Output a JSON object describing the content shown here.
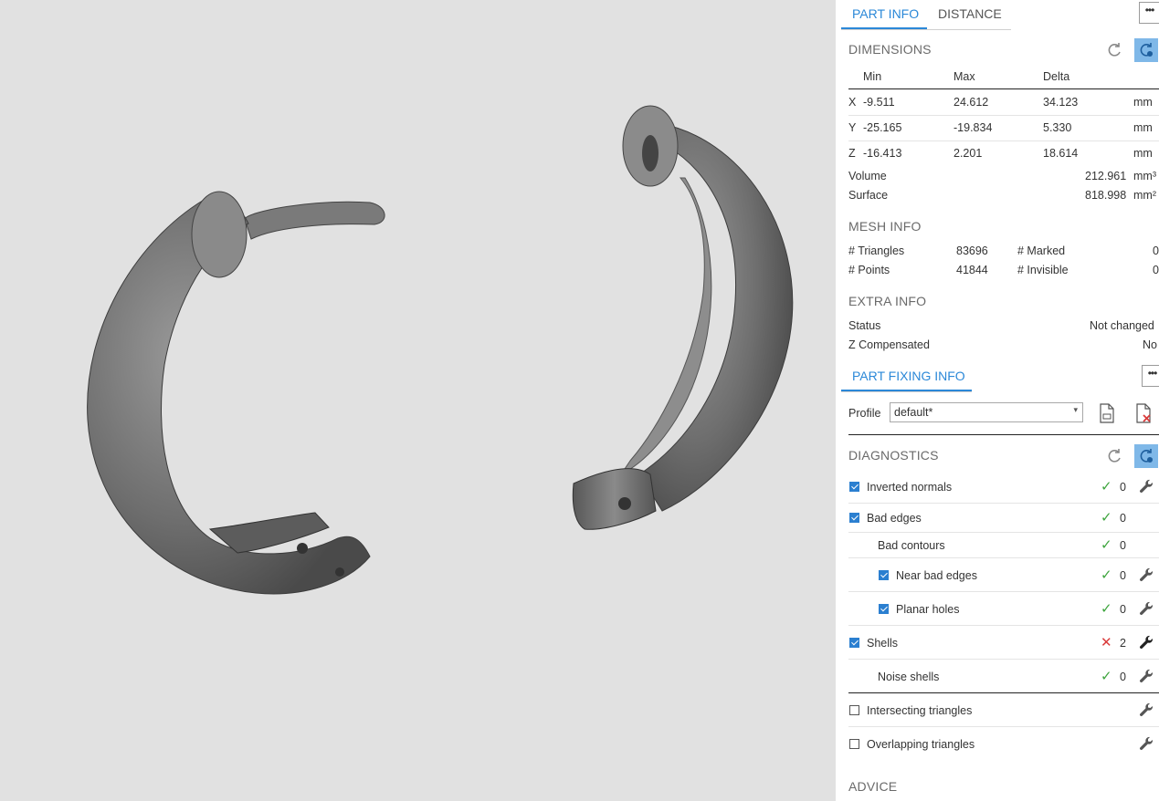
{
  "tabs": {
    "part_info": "PART INFO",
    "distance": "DISTANCE",
    "more": "•••"
  },
  "dimensions": {
    "title": "DIMENSIONS",
    "headers": {
      "min": "Min",
      "max": "Max",
      "delta": "Delta"
    },
    "rows": [
      {
        "axis": "X",
        "min": "-9.511",
        "max": "24.612",
        "delta": "34.123",
        "unit": "mm"
      },
      {
        "axis": "Y",
        "min": "-25.165",
        "max": "-19.834",
        "delta": "5.330",
        "unit": "mm"
      },
      {
        "axis": "Z",
        "min": "-16.413",
        "max": "2.201",
        "delta": "18.614",
        "unit": "mm"
      }
    ],
    "volume_label": "Volume",
    "volume_value": "212.961",
    "volume_unit": "mm³",
    "surface_label": "Surface",
    "surface_value": "818.998",
    "surface_unit": "mm²"
  },
  "mesh_info": {
    "title": "MESH INFO",
    "triangles_label": "# Triangles",
    "triangles_value": "83696",
    "points_label": "# Points",
    "points_value": "41844",
    "marked_label": "# Marked",
    "marked_value": "0",
    "invisible_label": "# Invisible",
    "invisible_value": "0"
  },
  "extra_info": {
    "title": "EXTRA INFO",
    "status_label": "Status",
    "status_value": "Not changed",
    "zcomp_label": "Z Compensated",
    "zcomp_value": "No"
  },
  "part_fixing": {
    "tab": "PART FIXING INFO",
    "more": "•••",
    "profile_label": "Profile",
    "profile_value": "default*"
  },
  "diagnostics": {
    "title": "DIAGNOSTICS",
    "items": [
      {
        "label": "Inverted normals",
        "checked": true,
        "status": "ok",
        "count": "0",
        "fix": true
      },
      {
        "label": "Bad edges",
        "checked": true,
        "status": "ok",
        "count": "0",
        "fix": false
      },
      {
        "label": "Bad contours",
        "checked": null,
        "status": "ok",
        "count": "0",
        "fix": false
      },
      {
        "label": "Near bad edges",
        "checked": true,
        "status": "ok",
        "count": "0",
        "fix": true
      },
      {
        "label": "Planar holes",
        "checked": true,
        "status": "ok",
        "count": "0",
        "fix": true
      },
      {
        "label": "Shells",
        "checked": true,
        "status": "bad",
        "count": "2",
        "fix": true
      },
      {
        "label": "Noise shells",
        "checked": null,
        "status": "ok",
        "count": "0",
        "fix": true
      },
      {
        "label": "Intersecting triangles",
        "checked": false,
        "status": "",
        "count": "",
        "fix": true
      },
      {
        "label": "Overlapping triangles",
        "checked": false,
        "status": "",
        "count": "",
        "fix": true
      }
    ]
  },
  "advice": {
    "title": "ADVICE"
  },
  "icons": {
    "ok": "checkmark-icon",
    "bad": "cross-icon",
    "fix": "wrench-icon",
    "refresh": "refresh-icon",
    "auto_refresh": "auto-refresh-icon",
    "export": "export-report-icon",
    "delete": "delete-report-icon"
  },
  "colors": {
    "accent": "#2b88d8",
    "ok": "#3ea53e",
    "bad": "#d93a3a",
    "viewport_bg": "#e1e1e1"
  }
}
